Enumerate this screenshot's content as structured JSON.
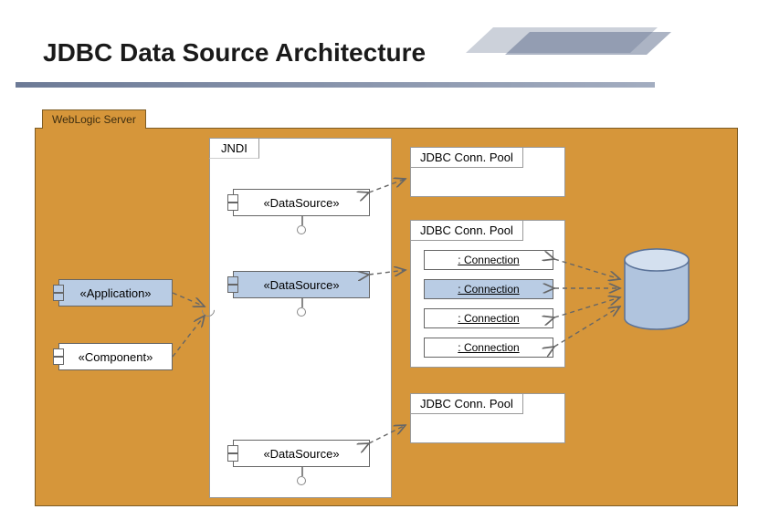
{
  "title": "JDBC Data Source Architecture",
  "server": {
    "label": "WebLogic Server"
  },
  "jndi": {
    "label": "JNDI",
    "datasources": [
      "«DataSource»",
      "«DataSource»",
      "«DataSource»"
    ]
  },
  "clients": {
    "application": "«Application»",
    "component": "«Component»"
  },
  "pools": {
    "label": "JDBC Conn. Pool",
    "connections": [
      ": Connection",
      ": Connection",
      ": Connection",
      ": Connection"
    ]
  }
}
